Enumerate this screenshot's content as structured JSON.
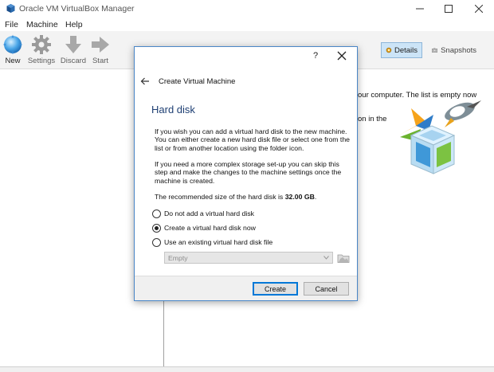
{
  "window": {
    "title": "Oracle VM VirtualBox Manager",
    "icon": "virtualbox-icon",
    "controls": [
      "minimize",
      "maximize",
      "close"
    ]
  },
  "menu": {
    "items": [
      {
        "label": "File"
      },
      {
        "label": "Machine"
      },
      {
        "label": "Help"
      }
    ]
  },
  "toolbar": {
    "new_label": "New",
    "settings_label": "Settings",
    "discard_label": "Discard",
    "start_label": "Start",
    "details_label": "Details",
    "snapshots_label": "Snapshots"
  },
  "welcome": {
    "line1": "our computer. The list is empty now",
    "line2": "on in the"
  },
  "dialog": {
    "help": "?",
    "title": "Create Virtual Machine",
    "heading": "Hard disk",
    "para1": "If you wish you can add a virtual hard disk to the new machine. You can either create a new hard disk file or select one from the list or from another location using the folder icon.",
    "para2": "If you need a more complex storage set-up you can skip this step and make the changes to the machine settings once the machine is created.",
    "recommend_prefix": "The recommended size of the hard disk is ",
    "recommend_size": "32.00 GB",
    "recommend_suffix": ".",
    "options": [
      {
        "label": "Do not add a virtual hard disk",
        "checked": false
      },
      {
        "label": "Create a virtual hard disk now",
        "checked": true
      },
      {
        "label": "Use an existing virtual hard disk file",
        "checked": false
      }
    ],
    "existing_file_value": "Empty",
    "create_label": "Create",
    "cancel_label": "Cancel"
  },
  "colors": {
    "accent": "#0078d7",
    "heading": "#1e3f73",
    "dialog_border": "#4a86c7",
    "details_selected": "#cce4f7"
  }
}
